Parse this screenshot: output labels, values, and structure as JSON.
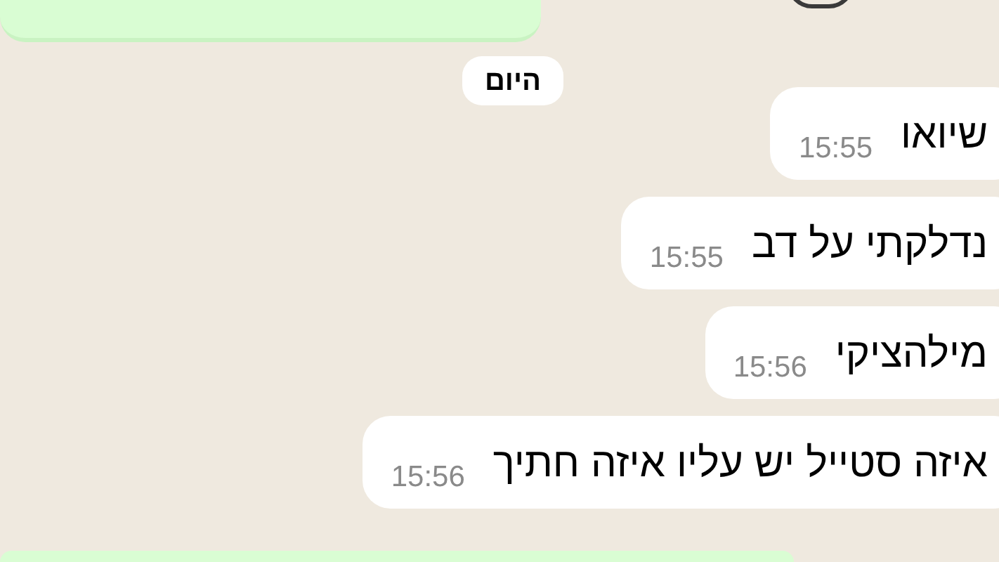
{
  "date_chip": "היום",
  "messages": [
    {
      "kind": "incoming",
      "text": "שיואו",
      "time": "15:55"
    },
    {
      "kind": "incoming",
      "text": "נדלקתי על דב",
      "time": "15:55"
    },
    {
      "kind": "incoming",
      "text": "מילהציקי",
      "time": "15:56"
    },
    {
      "kind": "incoming",
      "text": "איזה סטייל יש עליו איזה חתיך",
      "time": "15:56"
    }
  ]
}
